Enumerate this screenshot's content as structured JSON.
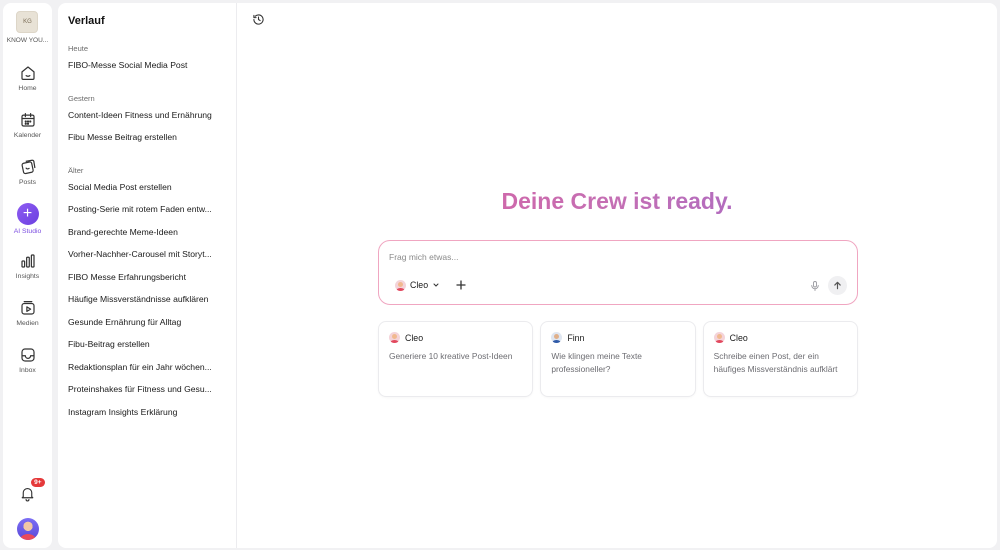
{
  "rail": {
    "brand_name": "KNOW YOU...",
    "brand_logo_text": "KG",
    "items": [
      {
        "label": "Home",
        "icon": "home-icon"
      },
      {
        "label": "Kalender",
        "icon": "calendar-icon"
      },
      {
        "label": "Posts",
        "icon": "posts-icon"
      },
      {
        "label": "AI Studio",
        "icon": "plus-icon",
        "active": true
      },
      {
        "label": "Insights",
        "icon": "bar-chart-icon"
      },
      {
        "label": "Medien",
        "icon": "media-icon"
      },
      {
        "label": "Inbox",
        "icon": "inbox-icon"
      }
    ],
    "notification_badge": "9+",
    "accent": "#7c4ee0"
  },
  "history": {
    "title": "Verlauf",
    "groups": [
      {
        "label": "Heute",
        "items": [
          "FIBO-Messe Social Media Post"
        ]
      },
      {
        "label": "Gestern",
        "items": [
          "Content-Ideen Fitness und Ernährung",
          "Fibu Messe Beitrag erstellen"
        ]
      },
      {
        "label": "Älter",
        "items": [
          "Social Media Post erstellen",
          "Posting-Serie mit rotem Faden entw...",
          "Brand-gerechte Meme-Ideen",
          "Vorher-Nachher-Carousel mit Storyt...",
          "FIBO Messe Erfahrungsbericht",
          "Häufige Missverständnisse aufklären",
          "Gesunde Ernährung für Alltag",
          "Fibu-Beitrag erstellen",
          "Redaktionsplan für ein Jahr wöchen...",
          "Proteinshakes für Fitness und Gesu...",
          "Instagram Insights Erklärung"
        ]
      }
    ]
  },
  "main": {
    "headline": "Deine Crew ist ready.",
    "headline_colors": [
      "#e45a97",
      "#8a66d6"
    ],
    "composer": {
      "placeholder": "Frag mich etwas...",
      "agent": "Cleo",
      "border_color": "#f0a6c1"
    },
    "suggestions": [
      {
        "agent": "Cleo",
        "text": "Generiere 10 kreative Post-Ideen"
      },
      {
        "agent": "Finn",
        "text": "Wie klingen meine Texte professioneller?"
      },
      {
        "agent": "Cleo",
        "text": "Schreibe einen Post, der ein häufiges Missverständnis aufklärt"
      }
    ]
  }
}
